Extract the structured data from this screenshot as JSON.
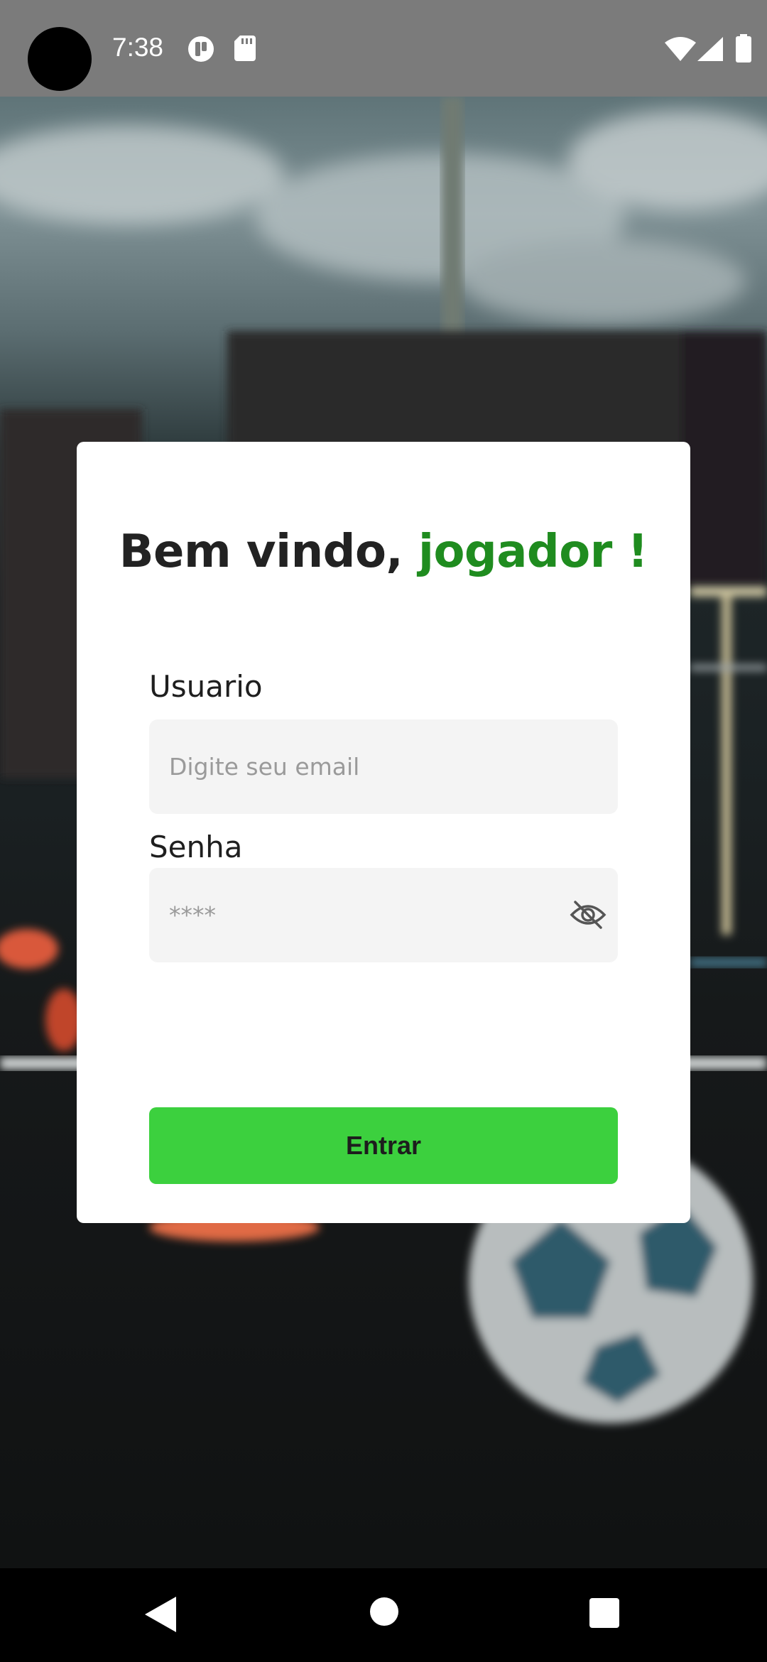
{
  "status_bar": {
    "time": "7:38",
    "icons": [
      "camera-cutout",
      "notification-icon",
      "sd-card-icon",
      "wifi-icon",
      "signal-icon",
      "battery-icon"
    ]
  },
  "login": {
    "title_prefix": "Bem vindo, ",
    "title_accent": "jogador !",
    "user_label": "Usuario",
    "user_placeholder": "Digite seu email",
    "password_label": "Senha",
    "password_placeholder": "****",
    "password_toggle_icon": "eye-off-icon",
    "submit_label": "Entrar"
  },
  "nav_bar": {
    "icons": [
      "back-icon",
      "home-icon",
      "recents-icon"
    ]
  },
  "colors": {
    "accent_text": "#1f8c1f",
    "button": "#3cd03e",
    "input_background": "#f4f4f4",
    "status_bar": "#7b7b7b"
  }
}
